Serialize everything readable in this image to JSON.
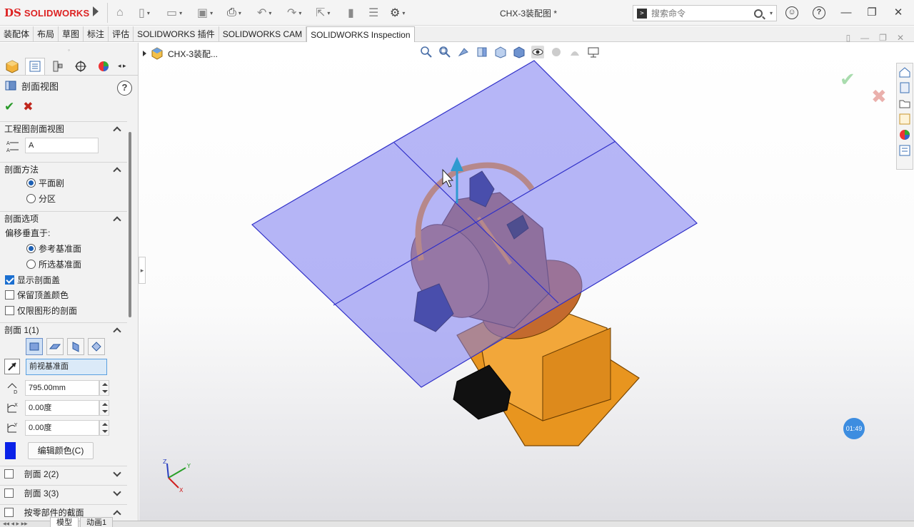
{
  "app": {
    "brand": "SOLIDWORKS",
    "brand_prefix": "DS",
    "document_title": "CHX-3装配图 *",
    "search_placeholder": "搜索命令"
  },
  "command_tabs": [
    {
      "label": "装配体"
    },
    {
      "label": "布局"
    },
    {
      "label": "草图"
    },
    {
      "label": "标注"
    },
    {
      "label": "评估"
    },
    {
      "label": "SOLIDWORKS 插件"
    },
    {
      "label": "SOLIDWORKS CAM"
    },
    {
      "label": "SOLIDWORKS Inspection",
      "active": true
    }
  ],
  "feature_tree": {
    "root_label": "CHX-3装配..."
  },
  "property_manager": {
    "title": "剖面视图",
    "help": "?",
    "ok": "✔",
    "cancel": "✖",
    "group_drawing_section": {
      "title": "工程图剖面视图",
      "name_value": "A"
    },
    "group_method": {
      "title": "剖面方法",
      "options": [
        "平面剧",
        "分区"
      ],
      "selected": "平面剧"
    },
    "group_options": {
      "title": "剖面选项",
      "offset_label": "偏移垂直于:",
      "offset_options": [
        "参考基准面",
        "所选基准面"
      ],
      "offset_selected": "参考基准面",
      "checkboxes": [
        {
          "label": "显示剖面盖",
          "checked": true
        },
        {
          "label": "保留顶盖颜色",
          "checked": false
        },
        {
          "label": "仅限图形的剖面",
          "checked": false
        }
      ]
    },
    "section1": {
      "title": "剖面 1(1)",
      "plane_value": "前视基准面",
      "distance_value": "795.00mm",
      "angle_x_value": "0.00度",
      "angle_y_value": "0.00度",
      "edit_color_label": "编辑颜色(C)",
      "color": "#0a22e8"
    },
    "section2": {
      "title": "剖面 2(2)"
    },
    "section3": {
      "title": "剖面 3(3)"
    },
    "section_by_part": {
      "title": "按零部件的截面"
    }
  },
  "bottom_tabs": [
    {
      "label": "模型"
    },
    {
      "label": "动画1"
    }
  ],
  "viewport": {
    "timer_badge": "01:49",
    "triad": {
      "x": "X",
      "y": "Y",
      "z": "Z"
    }
  },
  "colors": {
    "section_plane": "#8c8cf6",
    "model_body": "#f0a22e",
    "selection_highlight": "#3a5bd9",
    "brand_red": "#d22222"
  }
}
